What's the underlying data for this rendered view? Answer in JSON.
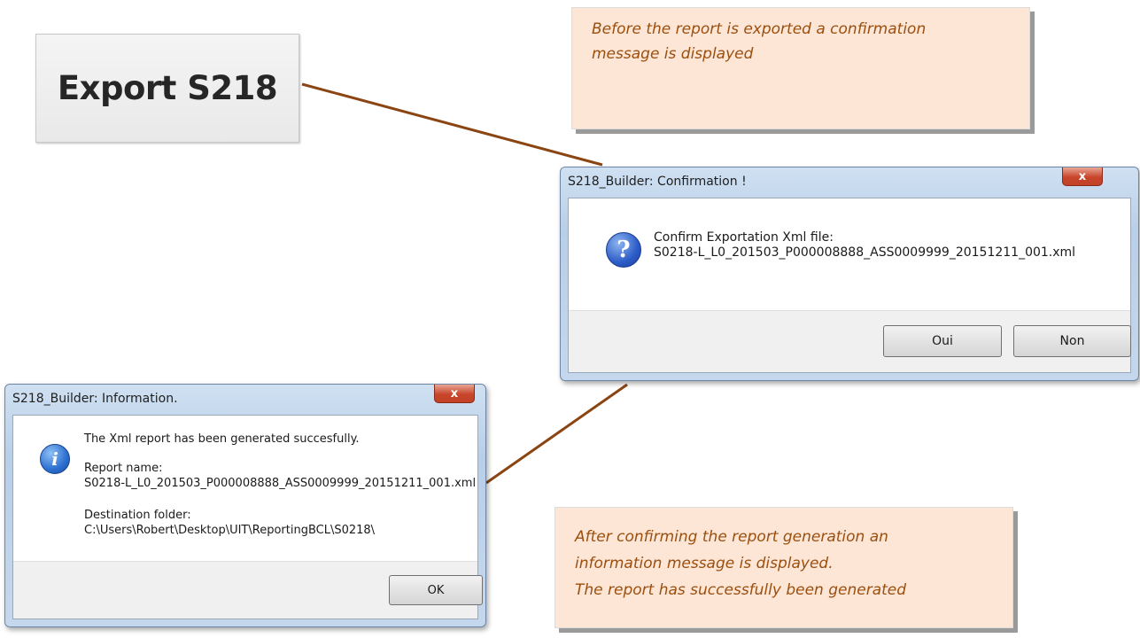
{
  "export_button": {
    "label": "Export S218"
  },
  "notes": {
    "top": [
      "Before the report is exported a confirmation",
      "message is displayed"
    ],
    "bottom": [
      "After confirming the report generation an",
      "information message is displayed.",
      "The report has successfully been generated"
    ]
  },
  "confirm_dialog": {
    "title": "S218_Builder: Confirmation !",
    "close_glyph": "x",
    "icon": "question-icon",
    "icon_glyph": "?",
    "message_line1": "Confirm Exportation Xml file:",
    "message_line2": "S0218-L_L0_201503_P000008888_ASS0009999_20151211_001.xml",
    "yes_label": "Oui",
    "no_label": "Non"
  },
  "info_dialog": {
    "title": "S218_Builder: Information.",
    "close_glyph": "x",
    "icon": "information-icon",
    "icon_glyph": "i",
    "message": "The Xml report has been  generated succesfully.",
    "report_name_label": "Report name:",
    "report_name": "S0218-L_L0_201503_P000008888_ASS0009999_20151211_001.xml",
    "destination_label": "Destination folder:",
    "destination": "C:\\Users\\Robert\\Desktop\\UIT\\ReportingBCL\\S0218\\",
    "ok_label": "OK"
  },
  "colors": {
    "connector": "#8b4513",
    "note_background": "#fde6d6",
    "note_text": "#9b4f0f"
  }
}
